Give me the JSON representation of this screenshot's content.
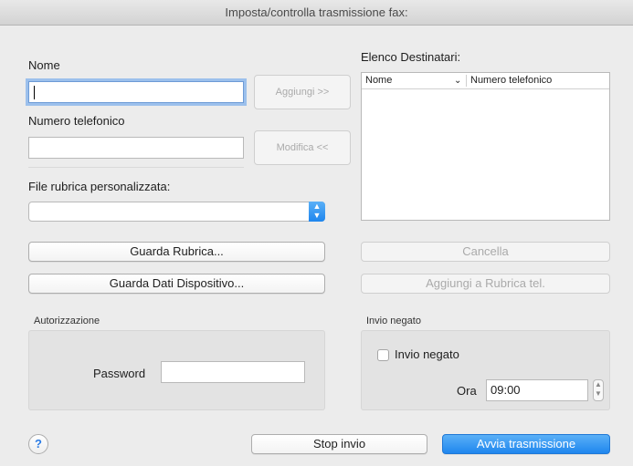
{
  "window": {
    "title": "Imposta/controlla trasmissione fax:"
  },
  "left": {
    "name_label": "Nome",
    "name_value": "",
    "phone_label": "Numero telefonico",
    "phone_value": "",
    "add_button": "Aggiungi >>",
    "modify_button": "Modifica <<",
    "phonebook_file_label": "File rubrica personalizzata:",
    "phonebook_file_value": "",
    "view_phonebook_button": "Guarda Rubrica...",
    "view_device_data_button": "Guarda Dati Dispositivo..."
  },
  "recipients": {
    "label": "Elenco Destinatari:",
    "columns": [
      "Nome",
      "Numero telefonico"
    ],
    "sort_icon": "chevron-down-icon",
    "rows": [],
    "delete_button": "Cancella",
    "add_to_phonebook_button": "Aggiungi a Rubrica tel."
  },
  "authorization": {
    "section_label": "Autorizzazione",
    "password_label": "Password",
    "password_value": ""
  },
  "deferred": {
    "section_label": "Invio negato",
    "checkbox_label": "Invio negato",
    "checked": false,
    "time_label": "Ora",
    "time_value": "09:00"
  },
  "footer": {
    "help": "?",
    "stop_button": "Stop invio",
    "start_button": "Avvia trasmissione"
  },
  "colors": {
    "accent": "#1f86ee",
    "window_bg": "#ececec"
  }
}
